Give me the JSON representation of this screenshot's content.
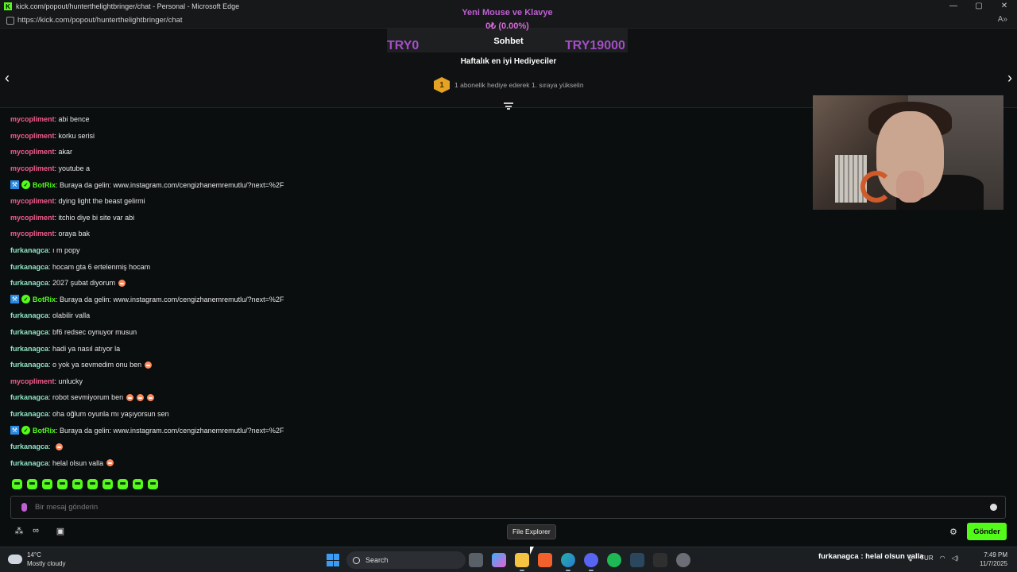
{
  "window": {
    "title": "kick.com/popout/hunterthelightbringer/chat - Personal - Microsoft Edge",
    "url": "https://kick.com/popout/hunterthelightbringer/chat",
    "controls": [
      "—",
      "▢",
      "✕"
    ]
  },
  "goal": {
    "title": "Yeni Mouse ve Klavye",
    "amount": "0₺ (0.00%)",
    "min": "TRY0",
    "max": "TRY19000",
    "progress_percent": 0
  },
  "header": {
    "tab_label": "Sohbet",
    "weekly_title": "Haftalık en iyi Hediyeciler",
    "rank_badge": "1",
    "gift_prompt": "1 abonelik hediye ederek 1. sıraya yükselin"
  },
  "colors": {
    "accent_green": "#53fc18",
    "user_pink": "#f25c8c",
    "user_teal": "#8fe3c4",
    "bot_green": "#53fc18",
    "goal_purple": "#a44ec6"
  },
  "messages": [
    {
      "user": "mycopliment",
      "text": "abi bence",
      "color": "#f25c8c",
      "emotes": 0
    },
    {
      "user": "mycopliment",
      "text": "korku serisi",
      "color": "#f25c8c",
      "emotes": 0
    },
    {
      "user": "mycopliment",
      "text": "akar",
      "color": "#f25c8c",
      "emotes": 0
    },
    {
      "user": "mycopliment",
      "text": "youtube a",
      "color": "#f25c8c",
      "emotes": 0
    },
    {
      "user": "BotRix",
      "text": "Buraya da gelin: www.instagram.com/cengizhanemremutlu/?next=%2F",
      "color": "#53fc18",
      "emotes": 0,
      "badges": true
    },
    {
      "user": "mycopliment",
      "text": "dying light the beast gelirmi",
      "color": "#f25c8c",
      "emotes": 0
    },
    {
      "user": "mycopliment",
      "text": "itchio diye bi site var abi",
      "color": "#f25c8c",
      "emotes": 0
    },
    {
      "user": "mycopliment",
      "text": "oraya bak",
      "color": "#f25c8c",
      "emotes": 0
    },
    {
      "user": "furkanagca",
      "text": "ı m popy",
      "color": "#8fe3c4",
      "emotes": 0
    },
    {
      "user": "furkanagca",
      "text": "hocam gta 6 ertelenmiş hocam",
      "color": "#8fe3c4",
      "emotes": 0
    },
    {
      "user": "furkanagca",
      "text": "2027 şubat diyorum",
      "color": "#8fe3c4",
      "emotes": 1
    },
    {
      "user": "BotRix",
      "text": "Buraya da gelin: www.instagram.com/cengizhanemremutlu/?next=%2F",
      "color": "#53fc18",
      "emotes": 0,
      "badges": true
    },
    {
      "user": "furkanagca",
      "text": "olabilir valla",
      "color": "#8fe3c4",
      "emotes": 0
    },
    {
      "user": "furkanagca",
      "text": "bf6 redsec oynuyor musun",
      "color": "#8fe3c4",
      "emotes": 0
    },
    {
      "user": "furkanagca",
      "text": "hadi ya nasıl atıyor la",
      "color": "#8fe3c4",
      "emotes": 0
    },
    {
      "user": "furkanagca",
      "text": "o yok ya sevmedim onu ben",
      "color": "#8fe3c4",
      "emotes": 1
    },
    {
      "user": "mycopliment",
      "text": "unlucky",
      "color": "#f25c8c",
      "emotes": 0
    },
    {
      "user": "furkanagca",
      "text": "robot sevmiyorum ben",
      "color": "#8fe3c4",
      "emotes": 3
    },
    {
      "user": "furkanagca",
      "text": "oha oğlum oyunla mı yaşıyorsun sen",
      "color": "#8fe3c4",
      "emotes": 0
    },
    {
      "user": "BotRix",
      "text": "Buraya da gelin: www.instagram.com/cengizhanemremutlu/?next=%2F",
      "color": "#53fc18",
      "emotes": 0,
      "badges": true
    },
    {
      "user": "furkanagca",
      "text": "",
      "color": "#8fe3c4",
      "emotes": 1
    },
    {
      "user": "furkanagca",
      "text": "helal olsun valla",
      "color": "#8fe3c4",
      "emotes": 1
    }
  ],
  "composer": {
    "placeholder": "Bir mesaj gönderin",
    "send_label": "Gönder"
  },
  "tooltip": "File Explorer",
  "taskbar": {
    "weather_temp": "14°C",
    "weather_desc": "Mostly cloudy",
    "search_label": "Search",
    "tray_overlay_text": "furkanagca : helal olsun valla",
    "language": "TUR",
    "time": "7:49 PM",
    "date": "11/7/2025"
  }
}
